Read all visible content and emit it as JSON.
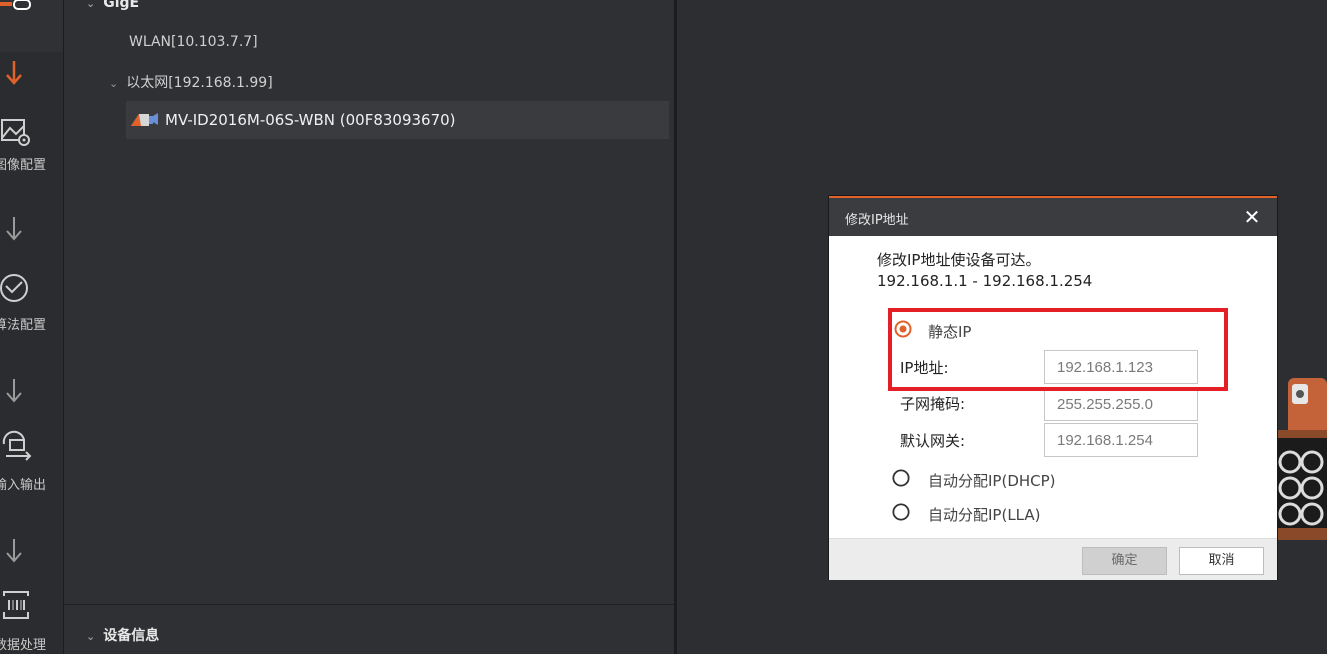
{
  "rail": {
    "steps": [
      {
        "label": "图像配置",
        "icon": "image-settings-icon"
      },
      {
        "label": "算法配置",
        "icon": "algorithm-icon"
      },
      {
        "label": "输入输出",
        "icon": "io-icon"
      },
      {
        "label": "数据处理",
        "icon": "data-processing-icon"
      }
    ],
    "accent": "#e0622a"
  },
  "tree": {
    "group_gige": "GigE",
    "wlan": "WLAN[10.103.7.7]",
    "ethernet": "以太网[192.168.1.99]",
    "device": "MV-ID2016M-06S-WBN (00F83093670)",
    "device_icon": "camera-icon",
    "bottom_section": "设备信息"
  },
  "dialog": {
    "title": "修改IP地址",
    "close_icon": "close-icon",
    "message_line1": "修改IP地址使设备可达。",
    "message_line2": "192.168.1.1 - 192.168.1.254",
    "options": {
      "static": "静态IP",
      "dhcp": "自动分配IP(DHCP)",
      "lla": "自动分配IP(LLA)"
    },
    "selected_option": "static",
    "fields": {
      "ip_label": "IP地址:",
      "ip_value": "192.168.1.123",
      "mask_label": "子网掩码:",
      "mask_value": "255.255.255.0",
      "gateway_label": "默认网关:",
      "gateway_value": "192.168.1.254"
    },
    "ok_label": "确定",
    "cancel_label": "取消",
    "highlight_color": "#e41f26"
  }
}
